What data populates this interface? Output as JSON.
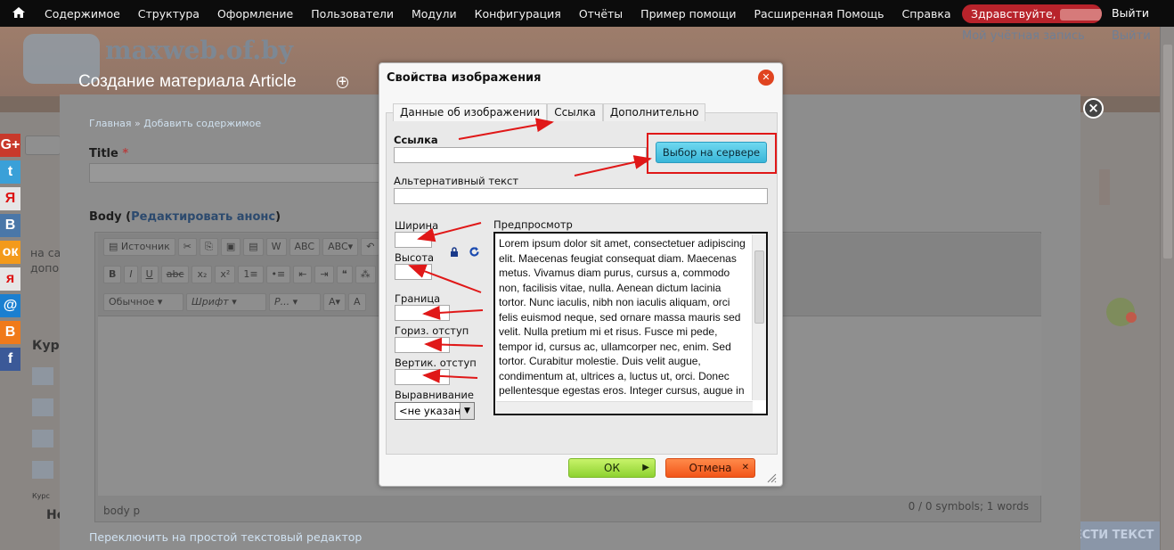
{
  "toolbar": {
    "menu": [
      "Содержимое",
      "Структура",
      "Оформление",
      "Пользователи",
      "Модули",
      "Конфигурация",
      "Отчёты",
      "Пример помощи",
      "Расширенная Помощь",
      "Справка"
    ],
    "hello": "Здравствуйте,",
    "logout": "Выйти"
  },
  "site": {
    "name": "maxweb.of.by",
    "user_link": "Мой учётная запись",
    "logout": "Выйти",
    "bottom_right": "ВЕСТИ ТЕКСТ"
  },
  "overlay": {
    "title": "Создание материала Article",
    "breadcrumb_home": "Главная",
    "breadcrumb_sep": "»",
    "breadcrumb_current": "Добавить содержимое",
    "title_label": "Title",
    "required_mark": "*",
    "body_label": "Body",
    "body_edit_link": "Редактировать анонс",
    "switch_link": "Переключить на простой текстовый редактор"
  },
  "editor": {
    "source_btn": "Источник",
    "format_select": "Обычное",
    "font_select": "Шрифт",
    "size_select": "Р...",
    "status_path": "body  p",
    "status_count": "0 / 0 symbols; 1 words"
  },
  "left": {
    "frag1": "на са",
    "frag2": "допо",
    "frag3": "Курс",
    "frag4": "Курс",
    "frag5": "Не"
  },
  "dialog": {
    "title": "Свойства изображения",
    "tabs": [
      "Данные об изображении",
      "Ссылка",
      "Дополнительно"
    ],
    "url_label": "Ссылка",
    "server_btn": "Выбор на сервере",
    "alt_label": "Альтернативный текст",
    "width_label": "Ширина",
    "height_label": "Высота",
    "border_label": "Граница",
    "hspace_label": "Гориз. отступ",
    "vspace_label": "Вертик. отступ",
    "align_label": "Выравнивание",
    "align_value": "<не указан",
    "preview_label": "Предпросмотр",
    "preview_text": "Lorem ipsum dolor sit amet, consectetuer adipiscing elit. Maecenas feugiat consequat diam. Maecenas metus. Vivamus diam purus, cursus a, commodo non, facilisis vitae, nulla. Aenean dictum lacinia tortor. Nunc iaculis, nibh non iaculis aliquam, orci felis euismod neque, sed ornare massa mauris sed velit. Nulla pretium mi et risus. Fusce mi pede, tempor id, cursus ac, ullamcorper nec, enim. Sed tortor. Curabitur molestie. Duis velit augue, condimentum at, ultrices a, luctus ut, orci. Donec pellentesque egestas eros. Integer cursus, augue in cursus faucibus, eros pede bibendum",
    "ok": "ОК",
    "cancel": "Отмена"
  },
  "colors": {
    "annotation": "#e01818",
    "ok": "#8ed230",
    "cancel": "#f25518",
    "server_btn": "#39b6d8"
  }
}
